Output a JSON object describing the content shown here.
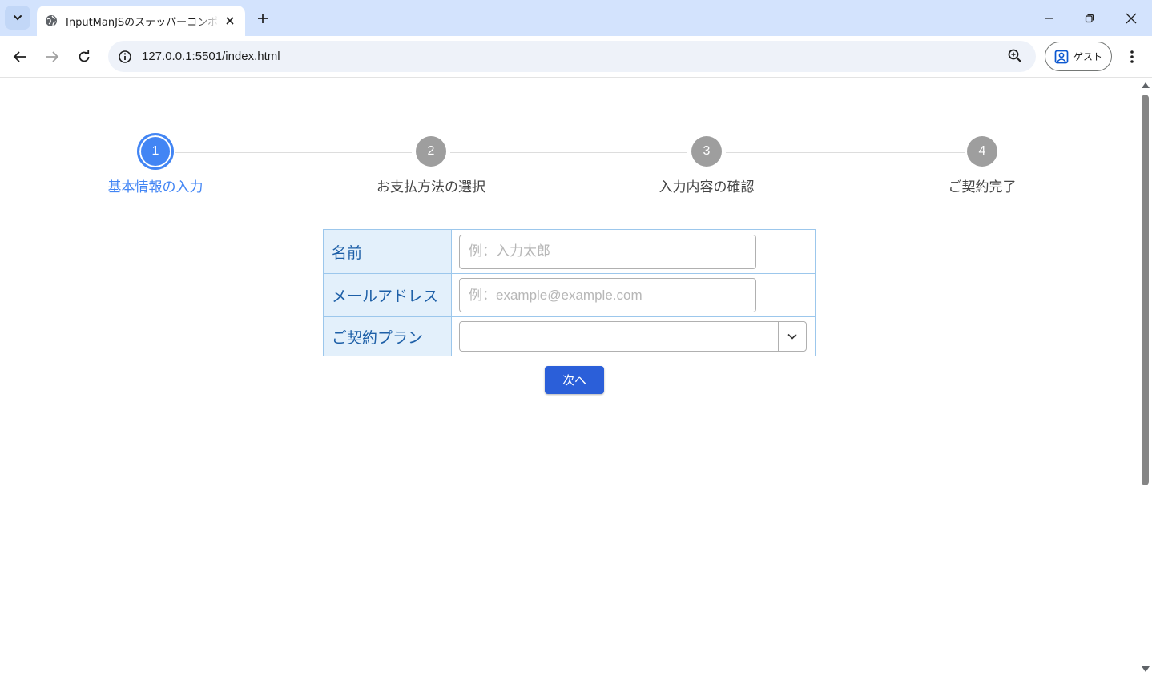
{
  "browser": {
    "tab_title": "InputManJSのステッパーコンポーネント",
    "url": "127.0.0.1:5501/index.html",
    "profile_label": "ゲスト"
  },
  "stepper": {
    "active_step": 1,
    "steps": [
      {
        "number": "1",
        "label": "基本情報の入力"
      },
      {
        "number": "2",
        "label": "お支払方法の選択"
      },
      {
        "number": "3",
        "label": "入力内容の確認"
      },
      {
        "number": "4",
        "label": "ご契約完了"
      }
    ]
  },
  "form": {
    "name_label": "名前",
    "name_placeholder": "例：入力太郎",
    "name_value": "",
    "email_label": "メールアドレス",
    "email_placeholder": "例：example@example.com",
    "email_value": "",
    "plan_label": "ご契約プラン",
    "plan_value": ""
  },
  "next_button_label": "次へ",
  "colors": {
    "active_step": "#4285f4",
    "inactive_step": "#9e9e9e",
    "header_cell_bg": "#e3f0fb",
    "header_cell_text": "#1d5fa7",
    "table_border": "#9cc7ec",
    "button_bg": "#2b5fd9"
  }
}
